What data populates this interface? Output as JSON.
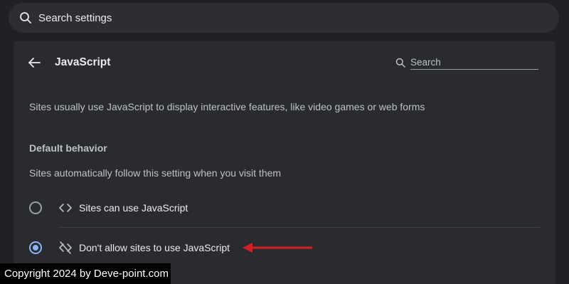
{
  "top_search": {
    "placeholder": "Search settings",
    "icon": "search-icon"
  },
  "header": {
    "back_icon": "arrow-left-icon",
    "title": "JavaScript",
    "search_placeholder": "Search",
    "search_icon": "search-icon"
  },
  "description": "Sites usually use JavaScript to display interactive features, like video games or web forms",
  "default_behavior": {
    "title": "Default behavior",
    "subtitle": "Sites automatically follow this setting when you visit them",
    "options": [
      {
        "label": "Sites can use JavaScript",
        "icon": "code-icon",
        "selected": false
      },
      {
        "label": "Don't allow sites to use JavaScript",
        "icon": "code-off-icon",
        "selected": true
      }
    ]
  },
  "annotation": {
    "arrow_color": "#d32027"
  },
  "watermark": "Copyright 2024 by Deve-point.com",
  "colors": {
    "accent": "#8ab4f8",
    "background": "#202124",
    "card": "#2a2b2e"
  }
}
